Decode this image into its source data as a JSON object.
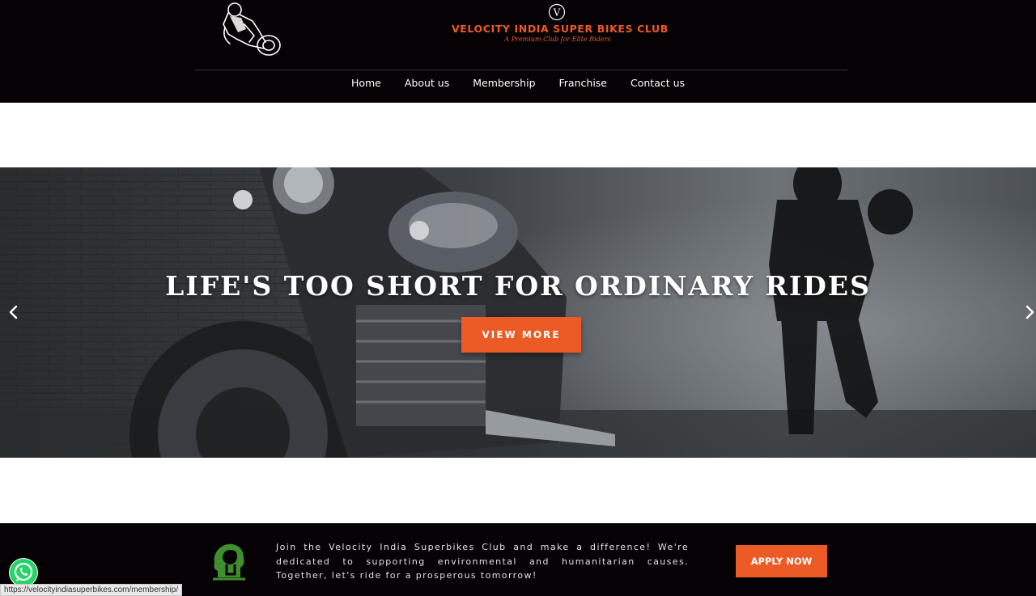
{
  "header": {
    "brand_title": "VELOCITY INDIA SUPER BIKES CLUB",
    "brand_tagline": "A Premium Club for Elite Riders",
    "brand_mark": "V",
    "nav": [
      {
        "label": "Home"
      },
      {
        "label": "About us"
      },
      {
        "label": "Membership"
      },
      {
        "label": "Franchise"
      },
      {
        "label": "Contact us"
      }
    ]
  },
  "hero": {
    "headline": "LIFE'S TOO SHORT FOR ORDINARY RIDES",
    "cta_label": "VIEW MORE",
    "prev_icon": "chevron-left-icon",
    "next_icon": "chevron-right-icon"
  },
  "band": {
    "text": "Join the Velocity India Superbikes Club and make a difference! We're dedicated to supporting environmental and humanitarian causes. Together, let's ride for a prosperous tomorrow!",
    "cta_label": "APPLY NOW",
    "icon": "eco-head-icon"
  },
  "status_bar": {
    "url": "https://velocityindiasuperbikes.com/membership/"
  },
  "colors": {
    "accent": "#ec5a25",
    "header_bg": "#060104",
    "band_bg": "#060104"
  }
}
